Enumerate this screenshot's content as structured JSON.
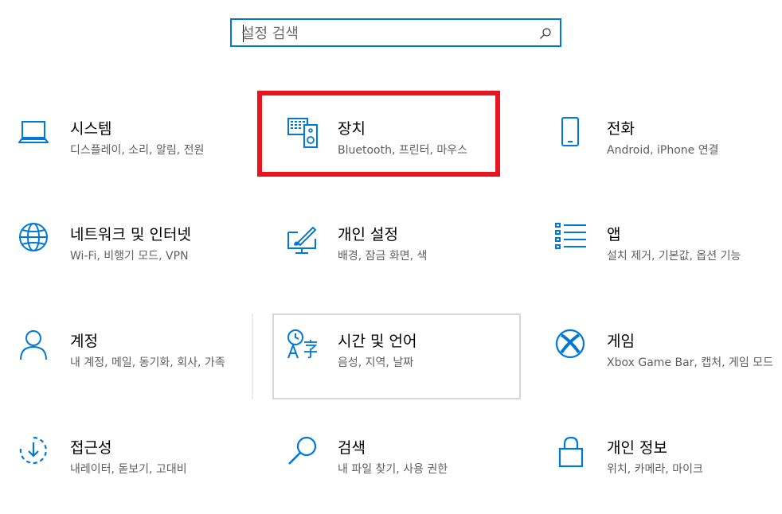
{
  "search": {
    "placeholder": "설정 검색",
    "value": ""
  },
  "accent_color": "#0078d7",
  "highlight_color": "#e8141e",
  "tiles": [
    {
      "title": "시스템",
      "desc": "디스플레이, 소리, 알림, 전원",
      "icon": "laptop-icon"
    },
    {
      "title": "장치",
      "desc": "Bluetooth, 프린터, 마우스",
      "icon": "devices-icon"
    },
    {
      "title": "전화",
      "desc": "Android, iPhone 연결",
      "icon": "phone-icon"
    },
    {
      "title": "네트워크 및 인터넷",
      "desc": "Wi-Fi, 비행기 모드, VPN",
      "icon": "globe-icon"
    },
    {
      "title": "개인 설정",
      "desc": "배경, 잠금 화면, 색",
      "icon": "personalization-icon"
    },
    {
      "title": "앱",
      "desc": "설치 제거, 기본값, 옵션 기능",
      "icon": "apps-list-icon"
    },
    {
      "title": "계정",
      "desc": "내 계정, 메일, 동기화, 회사, 가족",
      "icon": "person-icon"
    },
    {
      "title": "시간 및 언어",
      "desc": "음성, 지역, 날짜",
      "icon": "time-language-icon"
    },
    {
      "title": "게임",
      "desc": "Xbox Game Bar, 캡처, 게임 모드",
      "icon": "xbox-icon"
    },
    {
      "title": "접근성",
      "desc": "내레이터, 돋보기, 고대비",
      "icon": "accessibility-icon"
    },
    {
      "title": "검색",
      "desc": "내 파일 찾기, 사용 권한",
      "icon": "search-icon"
    },
    {
      "title": "개인 정보",
      "desc": "위치, 카메라, 마이크",
      "icon": "lock-icon"
    }
  ]
}
